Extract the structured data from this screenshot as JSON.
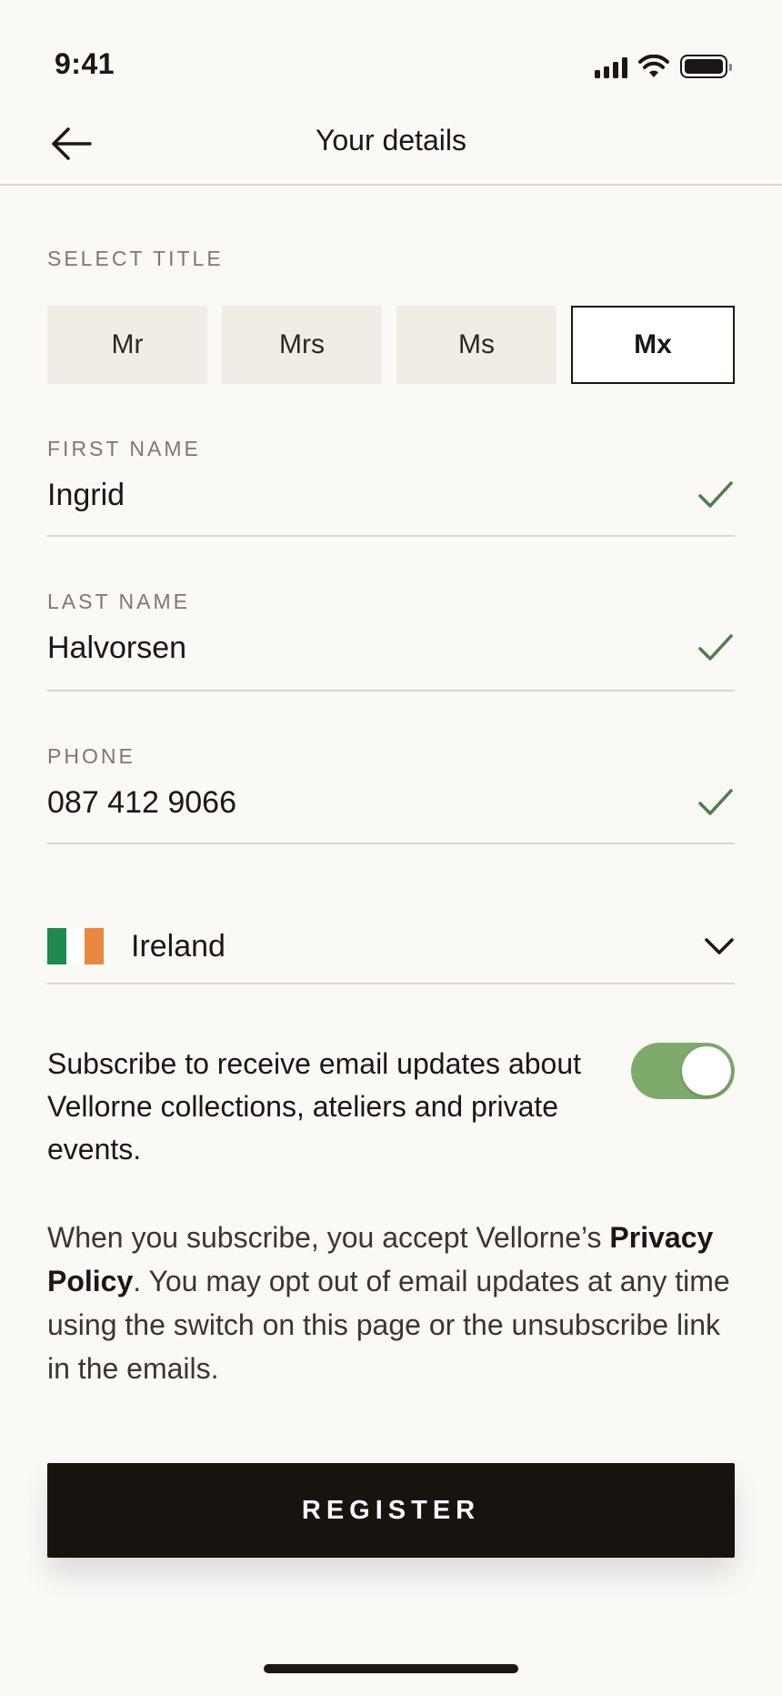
{
  "status_bar": {
    "time": "9:41",
    "icons": [
      "signal-icon",
      "wifi-icon",
      "battery-icon"
    ]
  },
  "nav": {
    "title": "Your details",
    "back_icon": "arrow-left-icon"
  },
  "title_select": {
    "label": "SELECT TITLE",
    "options": [
      "Mr",
      "Mrs",
      "Ms",
      "Mx"
    ],
    "selected": "Mx"
  },
  "fields": {
    "first_name": {
      "label": "FIRST NAME",
      "value": "Ingrid",
      "valid_icon": "check-icon"
    },
    "last_name": {
      "label": "LAST NAME",
      "value": "Halvorsen",
      "valid_icon": "check-icon"
    },
    "phone": {
      "label": "PHONE",
      "value": "087 412 9066",
      "valid_icon": "check-icon"
    }
  },
  "country": {
    "name": "Ireland",
    "flag_icon": "ireland-flag-icon",
    "flag_colors": [
      "#1e8a4f",
      "#ffffff",
      "#e8883e"
    ],
    "dropdown_icon": "chevron-down-icon"
  },
  "subscribe": {
    "text": "Subscribe to receive email updates about Vellorne collections, ateliers and private events.",
    "toggle_on": true
  },
  "policy": {
    "prefix": "When you subscribe, you accept Vellorne’s ",
    "link": "Privacy Policy",
    "suffix": ". You may opt out of email updates at any time using the switch on this page or the unsubscribe link in the emails."
  },
  "register_label": "REGISTER",
  "colors": {
    "background": "#faf9f6",
    "accent_dark": "#17130f",
    "toggle_green": "#7eab6b",
    "check_green": "#4f7d4a"
  }
}
